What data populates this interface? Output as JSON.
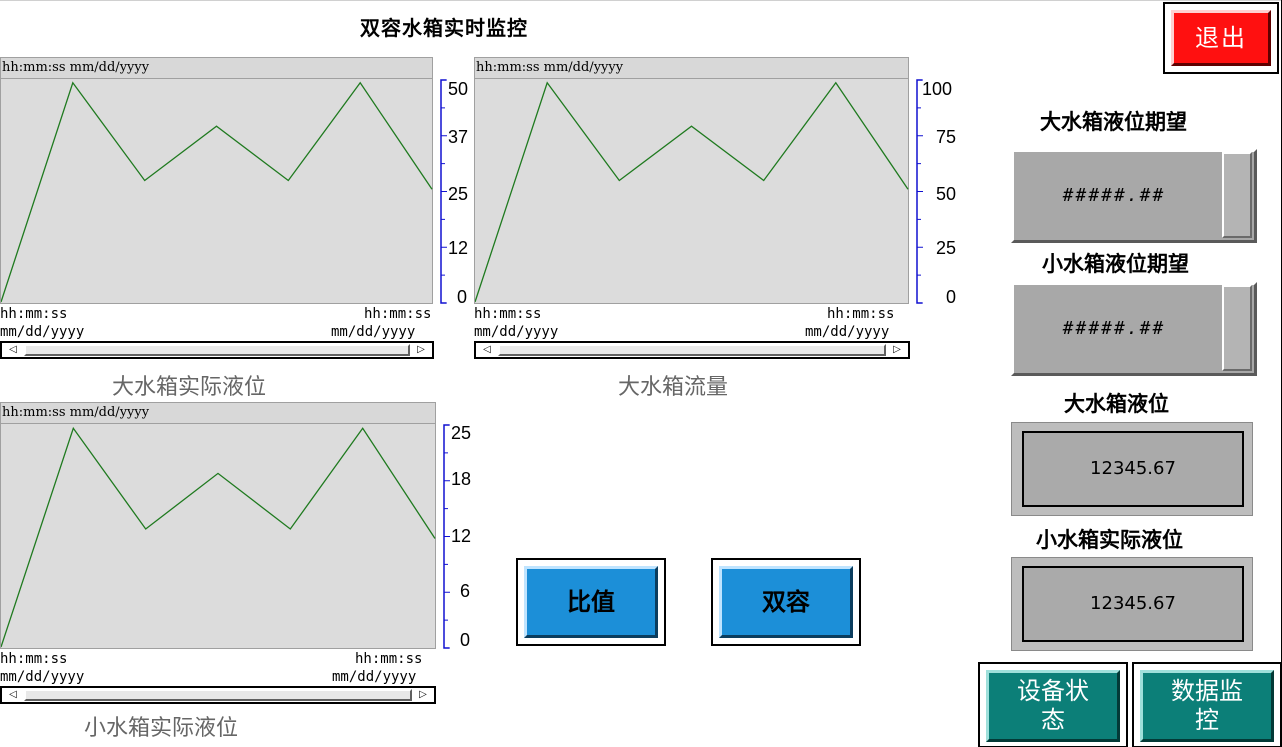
{
  "screen_title": "双容水箱实时监控",
  "exit_button": "退出",
  "trend_header": "hh:mm:ss  mm/dd/yyyy",
  "x_time_label": "hh:mm:ss",
  "x_date_label": "mm/dd/yyyy",
  "scroll_left_icon": "◁",
  "scroll_right_icon": "▷",
  "trends": [
    {
      "caption": "大水箱实际液位",
      "y_ticks": [
        "50",
        "37",
        "25",
        "12",
        "0"
      ],
      "y_range": [
        0,
        50
      ],
      "series": [
        0,
        50.5,
        28,
        40.5,
        28,
        50.5,
        26
      ]
    },
    {
      "caption": "大水箱流量",
      "y_ticks": [
        "100",
        "75",
        "50",
        "25",
        "0"
      ],
      "y_range": [
        0,
        100
      ],
      "series": [
        0,
        101,
        56,
        81,
        56,
        101,
        52
      ]
    },
    {
      "caption": "小水箱实际液位",
      "y_ticks": [
        "25",
        "18",
        "12",
        "6",
        "0"
      ],
      "y_range": [
        0,
        25
      ],
      "series": [
        0,
        25.2,
        13.6,
        20,
        13.6,
        25.2,
        12.5
      ]
    }
  ],
  "line_color": "#1f7a1f",
  "axis_color": "#1010d0",
  "right_panel": {
    "big_tank_setpoint_label": "大水箱液位期望",
    "big_tank_setpoint_value": "#####.##",
    "small_tank_setpoint_label": "小水箱液位期望",
    "small_tank_setpoint_value": "#####.##",
    "big_tank_level_label": "大水箱液位",
    "big_tank_level_value": "12345.67",
    "small_tank_level_label": "小水箱实际液位",
    "small_tank_level_value": "12345.67"
  },
  "buttons": {
    "ratio": "比值",
    "dual": "双容",
    "device_status_line1": "设备状",
    "device_status_line2": "态",
    "data_monitor_line1": "数据监",
    "data_monitor_line2": "控"
  }
}
